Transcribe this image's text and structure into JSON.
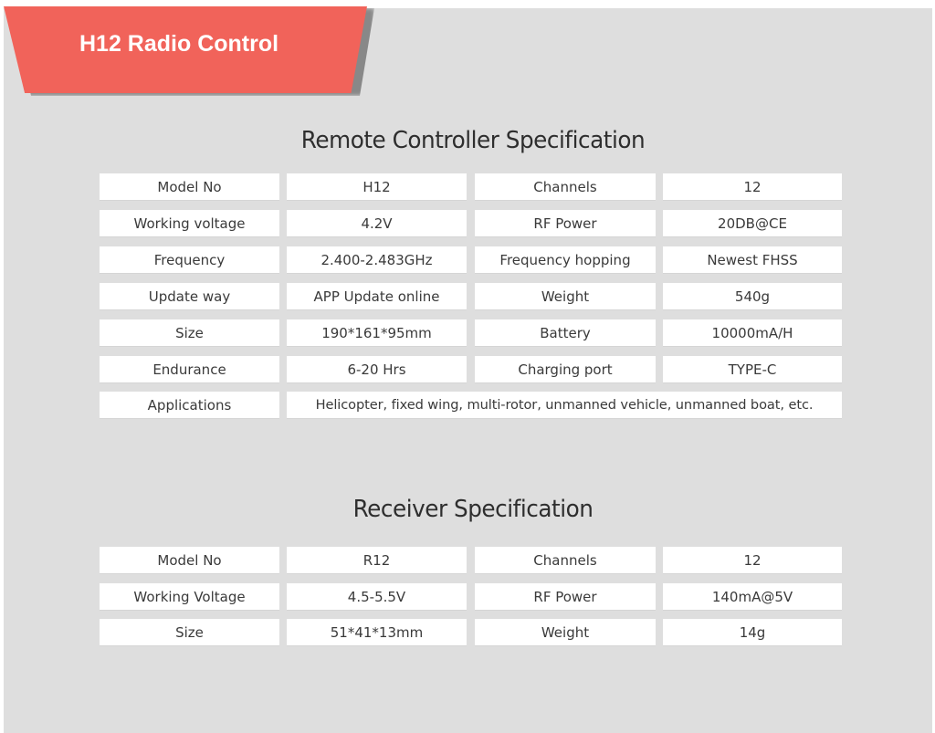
{
  "banner": {
    "title": "H12 Radio Control",
    "color": "#f1635a"
  },
  "remote_controller": {
    "title": "Remote Controller Specification",
    "rows": [
      {
        "label1": "Model No",
        "value1": "H12",
        "label2": "Channels",
        "value2": "12"
      },
      {
        "label1": "Working voltage",
        "value1": "4.2V",
        "label2": "RF Power",
        "value2": "20DB@CE"
      },
      {
        "label1": "Frequency",
        "value1": "2.400-2.483GHz",
        "label2": "Frequency hopping",
        "value2": "Newest FHSS"
      },
      {
        "label1": "Update way",
        "value1": "APP Update online",
        "label2": "Weight",
        "value2": "540g"
      },
      {
        "label1": "Size",
        "value1": "190*161*95mm",
        "label2": "Battery",
        "value2": "10000mA/H"
      },
      {
        "label1": "Endurance",
        "value1": "6-20 Hrs",
        "label2": "Charging port",
        "value2": "TYPE-C"
      }
    ],
    "applications": {
      "label": "Applications",
      "value": "Helicopter, fixed wing, multi-rotor, unmanned vehicle, unmanned boat, etc."
    }
  },
  "receiver": {
    "title": "Receiver Specification",
    "rows": [
      {
        "label1": "Model No",
        "value1": "R12",
        "label2": "Channels",
        "value2": "12"
      },
      {
        "label1": "Working Voltage",
        "value1": "4.5-5.5V",
        "label2": "RF Power",
        "value2": "140mA@5V"
      },
      {
        "label1": "Size",
        "value1": "51*41*13mm",
        "label2": "Weight",
        "value2": "14g"
      }
    ]
  }
}
